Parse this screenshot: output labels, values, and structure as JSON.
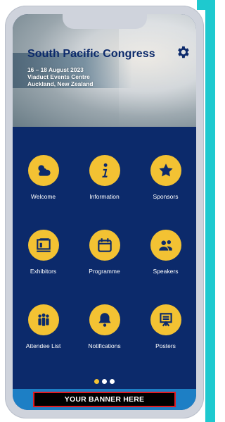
{
  "app": {
    "title": "South Pacific Congress",
    "dates": "16 – 18 August 2023",
    "venue": "Viaduct Events Centre",
    "location": "Auckland, New Zealand"
  },
  "tiles": [
    {
      "label": "Welcome",
      "icon": "weather-icon"
    },
    {
      "label": "Information",
      "icon": "info-icon"
    },
    {
      "label": "Sponsors",
      "icon": "star-icon"
    },
    {
      "label": "Exhibitors",
      "icon": "exhibitor-booth-icon"
    },
    {
      "label": "Programme",
      "icon": "calendar-icon"
    },
    {
      "label": "Speakers",
      "icon": "people-icon"
    },
    {
      "label": "Attendee List",
      "icon": "attendees-icon"
    },
    {
      "label": "Notifications",
      "icon": "bell-icon"
    },
    {
      "label": "Posters",
      "icon": "presentation-board-icon"
    }
  ],
  "pager": {
    "active_index": 1,
    "count": 3
  },
  "banner": {
    "text": "YOUR BANNER HERE"
  },
  "colors": {
    "accent": "#1ec9cf",
    "screen_bg": "#0c2a6b",
    "tile_yellow": "#f3c233",
    "footer_blue": "#1d7fc5",
    "banner_border": "#e11b22"
  }
}
